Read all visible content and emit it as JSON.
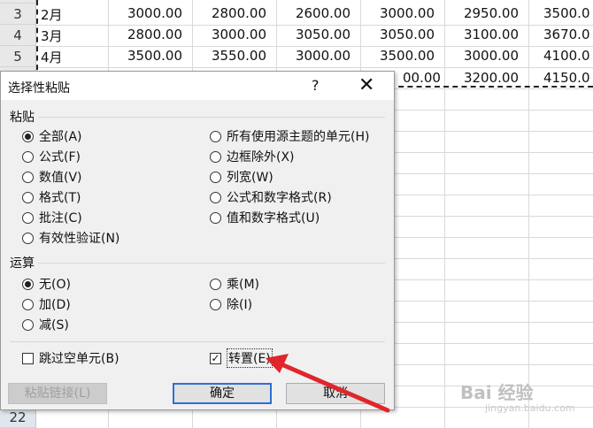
{
  "sheet": {
    "rows": [
      {
        "num": "3",
        "label": "2月",
        "values": [
          "3000.00",
          "2800.00",
          "2600.00",
          "3000.00",
          "2950.00",
          "3500.0"
        ]
      },
      {
        "num": "4",
        "label": "3月",
        "values": [
          "2800.00",
          "3000.00",
          "3050.00",
          "3050.00",
          "3100.00",
          "3670.0"
        ]
      },
      {
        "num": "5",
        "label": "4月",
        "values": [
          "3500.00",
          "3550.00",
          "3000.00",
          "3500.00",
          "3000.00",
          "4100.0"
        ]
      },
      {
        "num": "",
        "label": "",
        "values": [
          "",
          "",
          "",
          "00.00",
          "3200.00",
          "4150.0"
        ]
      }
    ],
    "last_row_num": "22"
  },
  "dialog": {
    "title": "选择性粘贴",
    "help": "?",
    "close": "✕",
    "paste_group": "粘贴",
    "paste_left": [
      {
        "label": "全部(A)",
        "selected": true
      },
      {
        "label": "公式(F)",
        "selected": false
      },
      {
        "label": "数值(V)",
        "selected": false
      },
      {
        "label": "格式(T)",
        "selected": false
      },
      {
        "label": "批注(C)",
        "selected": false
      },
      {
        "label": "有效性验证(N)",
        "selected": false
      }
    ],
    "paste_right": [
      {
        "label": "所有使用源主题的单元(H)",
        "selected": false
      },
      {
        "label": "边框除外(X)",
        "selected": false
      },
      {
        "label": "列宽(W)",
        "selected": false
      },
      {
        "label": "公式和数字格式(R)",
        "selected": false
      },
      {
        "label": "值和数字格式(U)",
        "selected": false
      }
    ],
    "op_group": "运算",
    "op_left": [
      {
        "label": "无(O)",
        "selected": true
      },
      {
        "label": "加(D)",
        "selected": false
      },
      {
        "label": "减(S)",
        "selected": false
      }
    ],
    "op_right": [
      {
        "label": "乘(M)",
        "selected": false
      },
      {
        "label": "除(I)",
        "selected": false
      }
    ],
    "skip_blanks": {
      "label": "跳过空单元(B)",
      "checked": false
    },
    "transpose": {
      "label": "转置(E)",
      "checked": true
    },
    "paste_link_button": "粘贴链接(L)",
    "ok_button": "确定",
    "cancel_button": "取消"
  },
  "watermark": "Bai 经验",
  "watermark_sub": "jingyan.baidu.com",
  "colors": {
    "arrow": "#e0262b",
    "accent": "#2f6fd1"
  }
}
